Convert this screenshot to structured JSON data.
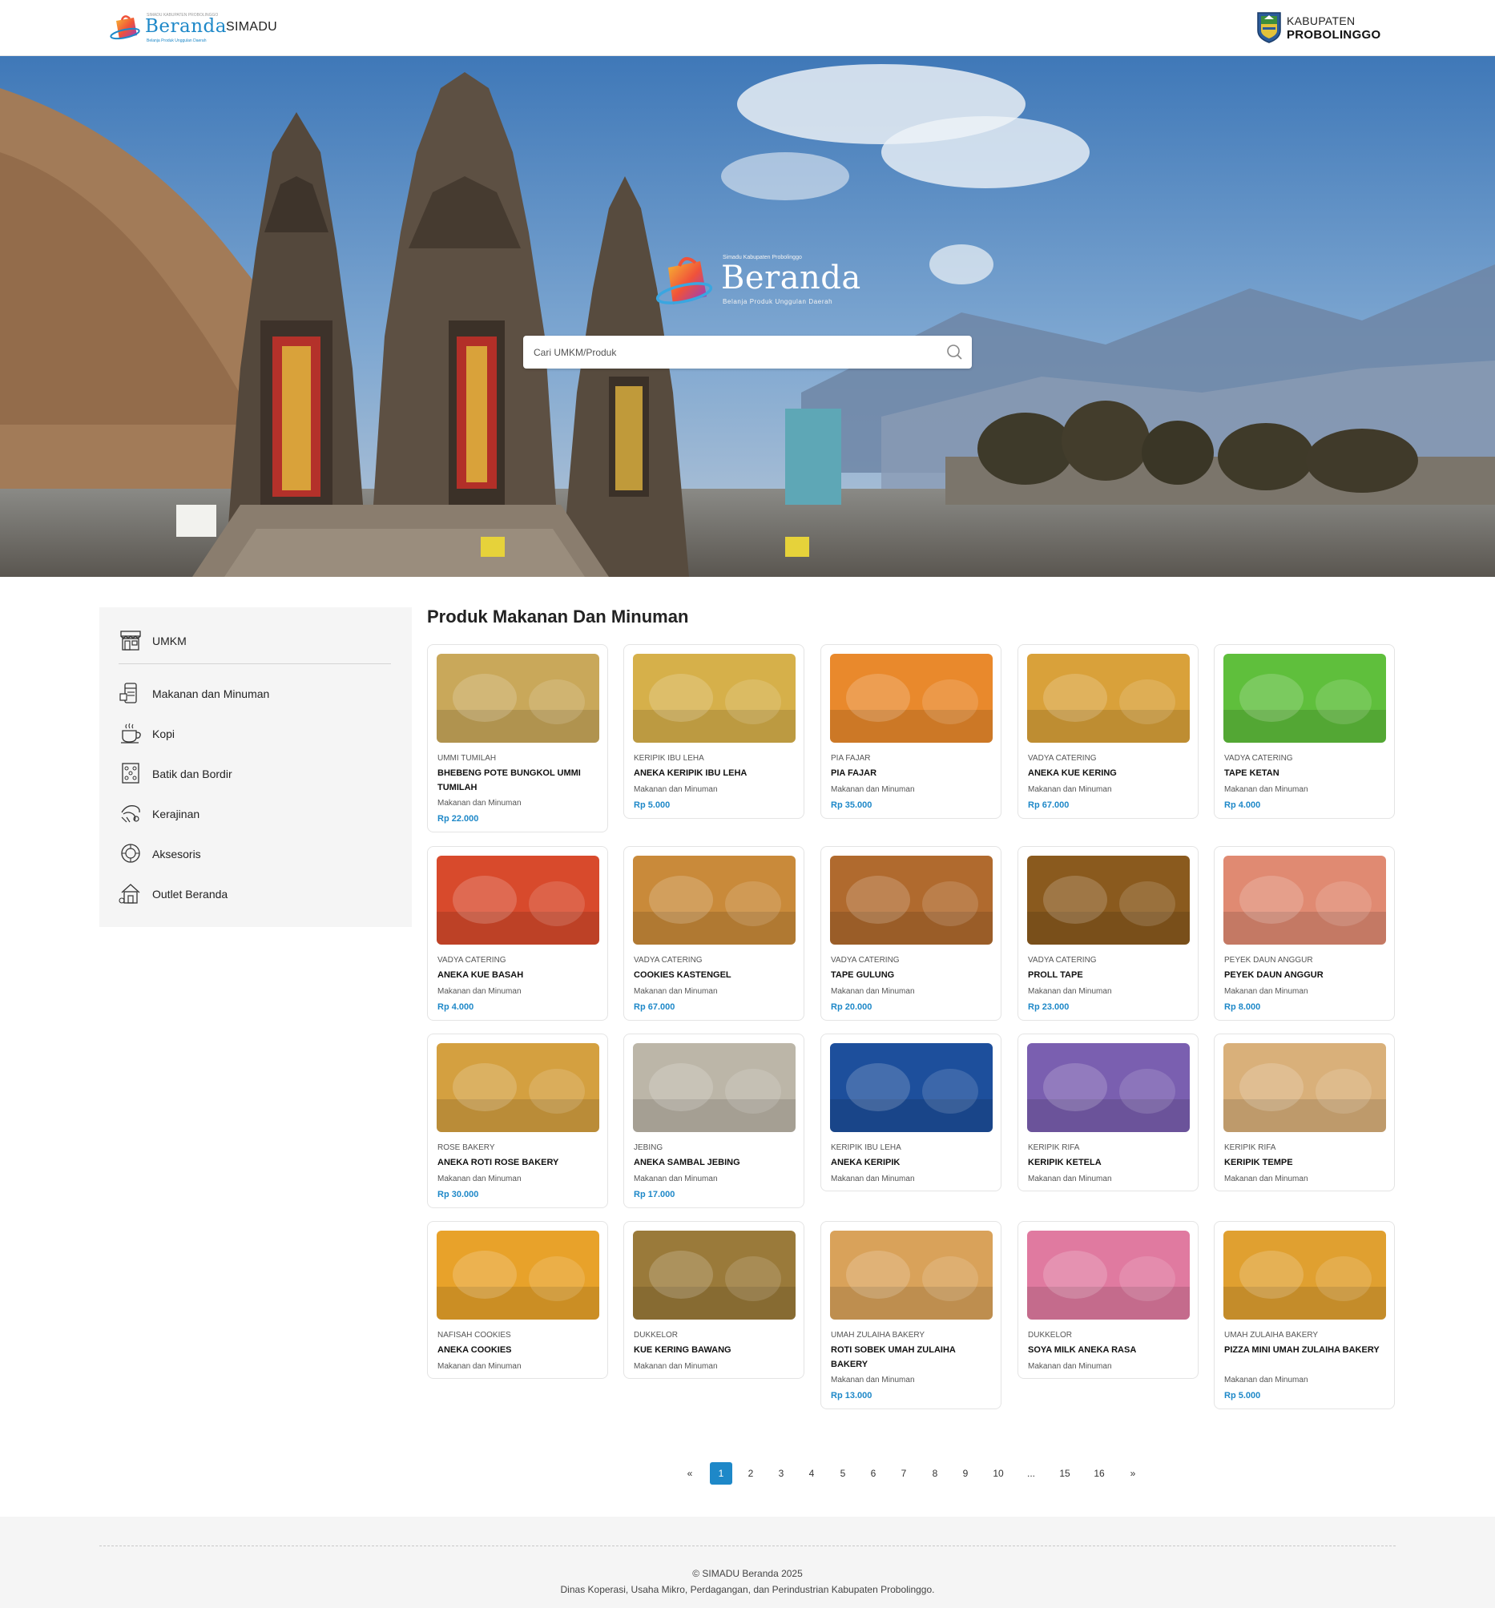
{
  "header": {
    "brand": "SIMADU",
    "logo_word": "Beranda",
    "logo_small_top": "SIMADU KABUPATEN PROBOLINGGO",
    "logo_small_bottom": "Belanja Produk Unggulan Daerah",
    "kabupaten_line1": "KABUPATEN",
    "kabupaten_line2": "PROBOLINGGO"
  },
  "hero": {
    "logo_word": "Beranda",
    "logo_top": "Simadu Kabupaten Probolinggo",
    "logo_bottom": "Belanja Produk Unggulan Daerah",
    "search_placeholder": "Cari UMKM/Produk"
  },
  "sidebar": {
    "umkm": {
      "label": "UMKM",
      "icon": "store-icon"
    },
    "items": [
      {
        "label": "Makanan dan Minuman",
        "icon": "food-drink-icon"
      },
      {
        "label": "Kopi",
        "icon": "coffee-cup-icon"
      },
      {
        "label": "Batik dan Bordir",
        "icon": "batik-pattern-icon"
      },
      {
        "label": "Kerajinan",
        "icon": "craft-icon"
      },
      {
        "label": "Aksesoris",
        "icon": "accessory-icon"
      },
      {
        "label": "Outlet Beranda",
        "icon": "outlet-house-icon"
      }
    ]
  },
  "main": {
    "title": "Produk Makanan Dan Minuman",
    "products": [
      {
        "seller": "UMMI TUMILAH",
        "name": "BHEBENG POTE BUNGKOL UMMI TUMILAH",
        "category": "Makanan dan Minuman",
        "price": "Rp 22.000",
        "thumb": "#c9a85a"
      },
      {
        "seller": "KERIPIK IBU LEHA",
        "name": "ANEKA KERIPIK IBU LEHA",
        "category": "Makanan dan Minuman",
        "price": "Rp 5.000",
        "thumb": "#d6b04a"
      },
      {
        "seller": "PIA FAJAR",
        "name": "PIA FAJAR",
        "category": "Makanan dan Minuman",
        "price": "Rp 35.000",
        "thumb": "#e9892c"
      },
      {
        "seller": "VADYA CATERING",
        "name": "ANEKA KUE KERING",
        "category": "Makanan dan Minuman",
        "price": "Rp 67.000",
        "thumb": "#d9a13a"
      },
      {
        "seller": "VADYA CATERING",
        "name": "TAPE KETAN",
        "category": "Makanan dan Minuman",
        "price": "Rp 4.000",
        "thumb": "#5fbf3c"
      },
      {
        "seller": "VADYA CATERING",
        "name": "ANEKA KUE BASAH",
        "category": "Makanan dan Minuman",
        "price": "Rp 4.000",
        "thumb": "#d84a2c"
      },
      {
        "seller": "VADYA CATERING",
        "name": "COOKIES KASTENGEL",
        "category": "Makanan dan Minuman",
        "price": "Rp 67.000",
        "thumb": "#c98a3a"
      },
      {
        "seller": "VADYA CATERING",
        "name": "TAPE GULUNG",
        "category": "Makanan dan Minuman",
        "price": "Rp 20.000",
        "thumb": "#b06a2e"
      },
      {
        "seller": "VADYA CATERING",
        "name": "PROLL TAPE",
        "category": "Makanan dan Minuman",
        "price": "Rp 23.000",
        "thumb": "#8a5a1e"
      },
      {
        "seller": "PEYEK DAUN ANGGUR",
        "name": "PEYEK DAUN ANGGUR",
        "category": "Makanan dan Minuman",
        "price": "Rp 8.000",
        "thumb": "#e08a72"
      },
      {
        "seller": "ROSE BAKERY",
        "name": "ANEKA ROTI ROSE BAKERY",
        "category": "Makanan dan Minuman",
        "price": "Rp 30.000",
        "thumb": "#d4a040"
      },
      {
        "seller": "JEBING",
        "name": "ANEKA SAMBAL JEBING",
        "category": "Makanan dan Minuman",
        "price": "Rp 17.000",
        "thumb": "#bcb6a8"
      },
      {
        "seller": "KERIPIK IBU LEHA",
        "name": "ANEKA KERIPIK",
        "category": "Makanan dan Minuman",
        "price": "",
        "thumb": "#1d4f9c"
      },
      {
        "seller": "KERIPIK RIFA",
        "name": "KERIPIK KETELA",
        "category": "Makanan dan Minuman",
        "price": "",
        "thumb": "#7a5fb0"
      },
      {
        "seller": "KERIPIK RIFA",
        "name": "KERIPIK TEMPE",
        "category": "Makanan dan Minuman",
        "price": "",
        "thumb": "#d9b07a"
      },
      {
        "seller": "NAFISAH COOKIES",
        "name": "ANEKA COOKIES",
        "category": "Makanan dan Minuman",
        "price": "",
        "thumb": "#e8a22a"
      },
      {
        "seller": "DUKKELOR",
        "name": "KUE KERING BAWANG",
        "category": "Makanan dan Minuman",
        "price": "",
        "thumb": "#9a7a3a"
      },
      {
        "seller": "UMAH ZULAIHA BAKERY",
        "name": "ROTI SOBEK UMAH ZULAIHA BAKERY",
        "category": "Makanan dan Minuman",
        "price": "Rp 13.000",
        "thumb": "#d9a25a"
      },
      {
        "seller": "DUKKELOR",
        "name": "SOYA MILK ANEKA RASA",
        "category": "Makanan dan Minuman",
        "price": "",
        "thumb": "#e07aa0"
      },
      {
        "seller": "UMAH ZULAIHA BAKERY",
        "name": "PIZZA MINI UMAH ZULAIHA BAKERY",
        "category": "Makanan dan Minuman",
        "price": "Rp 5.000",
        "thumb": "#e0a030"
      }
    ]
  },
  "pagination": {
    "prev": "«",
    "pages": [
      "1",
      "2",
      "3",
      "4",
      "5",
      "6",
      "7",
      "8",
      "9",
      "10",
      "...",
      "15",
      "16"
    ],
    "next": "»",
    "current": "1"
  },
  "footer": {
    "copyright": "© SIMADU Beranda 2025",
    "dinas": "Dinas Koperasi, Usaha Mikro, Perdagangan, dan Perindustrian Kabupaten Probolinggo."
  },
  "colors": {
    "accent": "#1e88c8",
    "sidebar_bg": "#f5f5f5",
    "footer_bg": "#f5f5f5"
  }
}
